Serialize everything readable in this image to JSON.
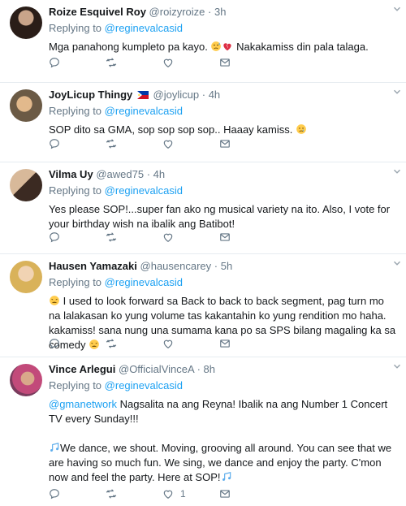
{
  "replies": [
    {
      "name": "Roize Esquivel Roy",
      "handle": "@roizyroize",
      "time": "3h",
      "replying_label": "Replying to",
      "replying_to": "@reginevalcasid",
      "text_a": "Mga panahong kumpleto pa kayo.",
      "text_b": "Nakakamiss din pala talaga."
    },
    {
      "name": "JoyLicup Thingy",
      "handle": "@joylicup",
      "time": "4h",
      "replying_label": "Replying to",
      "replying_to": "@reginevalcasid",
      "text_a": "SOP dito sa GMA, sop sop sop sop.. Haaay kamiss."
    },
    {
      "name": "Vilma Uy",
      "handle": "@awed75",
      "time": "4h",
      "replying_label": "Replying to",
      "replying_to": "@reginevalcasid",
      "text_a": "Yes please SOP!...super fan ako ng musical variety na ito. Also, I vote for your birthday wish na ibalik ang Batibot!"
    },
    {
      "name": "Hausen Yamazaki",
      "handle": "@hausencarey",
      "time": "5h",
      "replying_label": "Replying to",
      "replying_to": "@reginevalcasid",
      "text_a": "I used to look forward sa Back to back to back segment, pag turn mo na lalakasan ko yung volume tas kakantahin ko yung rendition mo haha. kakamiss! sana nung una sumama kana po sa SPS bilang magaling ka sa comedy"
    },
    {
      "name": "Vince Arlegui",
      "handle": "@OfficialVinceA",
      "time": "8h",
      "replying_label": "Replying to",
      "replying_to": "@reginevalcasid",
      "mention": "@gmanetwork",
      "text_a": "Nagsalita na ang Reyna! Ibalik na ang Number 1 Concert TV every Sunday!!!",
      "text_b": "We dance, we shout. Moving, grooving all around. You can see that we are having so much fun. We sing, we dance and enjoy the party. C'mon now and feel the party. Here at SOP!",
      "like_count": "1"
    }
  ],
  "colors": {
    "accent": "#1da1f2",
    "muted": "#657786",
    "text": "#14171a",
    "divider": "#e6ecf0"
  },
  "icons": [
    "reply-icon",
    "retweet-icon",
    "like-icon",
    "dm-icon",
    "caret-down-icon"
  ]
}
